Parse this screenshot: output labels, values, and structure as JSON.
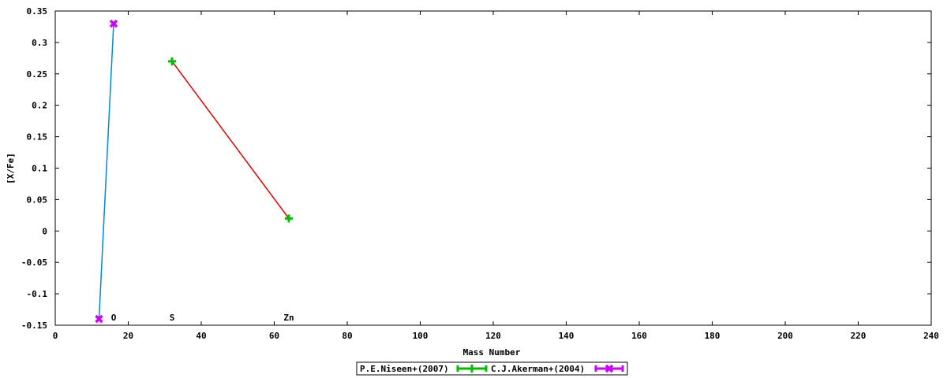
{
  "chart_data": {
    "type": "line",
    "title": "",
    "xlabel": "Mass Number",
    "ylabel": "[X/Fe]",
    "xlim": [
      0,
      240
    ],
    "ylim": [
      -0.15,
      0.35
    ],
    "x_ticks": [
      0,
      20,
      40,
      60,
      80,
      100,
      120,
      140,
      160,
      180,
      200,
      220,
      240
    ],
    "y_ticks": [
      -0.15,
      -0.1,
      -0.05,
      0,
      0.05,
      0.1,
      0.15,
      0.2,
      0.25,
      0.3,
      0.35
    ],
    "y_tick_labels": [
      "-0.15",
      "-0.1",
      "-0.05",
      "0",
      "0.05",
      "0.1",
      "0.15",
      "0.2",
      "0.25",
      "0.3",
      "0.35"
    ],
    "x_tick_labels": [
      "0",
      "20",
      "40",
      "60",
      "80",
      "100",
      "120",
      "140",
      "160",
      "180",
      "200",
      "220",
      "240"
    ],
    "grid": false,
    "legend_position": "bottom-center",
    "element_labels": [
      {
        "text": "O",
        "x": 16
      },
      {
        "text": "S",
        "x": 32
      },
      {
        "text": "Zn",
        "x": 64
      }
    ],
    "series": [
      {
        "name": "P.E.Niseen+(2007)",
        "color": "#00bb00",
        "line_color": "#dd0000",
        "marker": "plus",
        "points": [
          {
            "x": 32,
            "y": 0.27
          },
          {
            "x": 64,
            "y": 0.02
          }
        ]
      },
      {
        "name": "C.J.Akerman+(2004)",
        "color": "#cc00ff",
        "line_color": "#0088dd",
        "marker": "cross",
        "points": [
          {
            "x": 12,
            "y": -0.14
          },
          {
            "x": 16,
            "y": 0.33
          }
        ]
      }
    ]
  }
}
